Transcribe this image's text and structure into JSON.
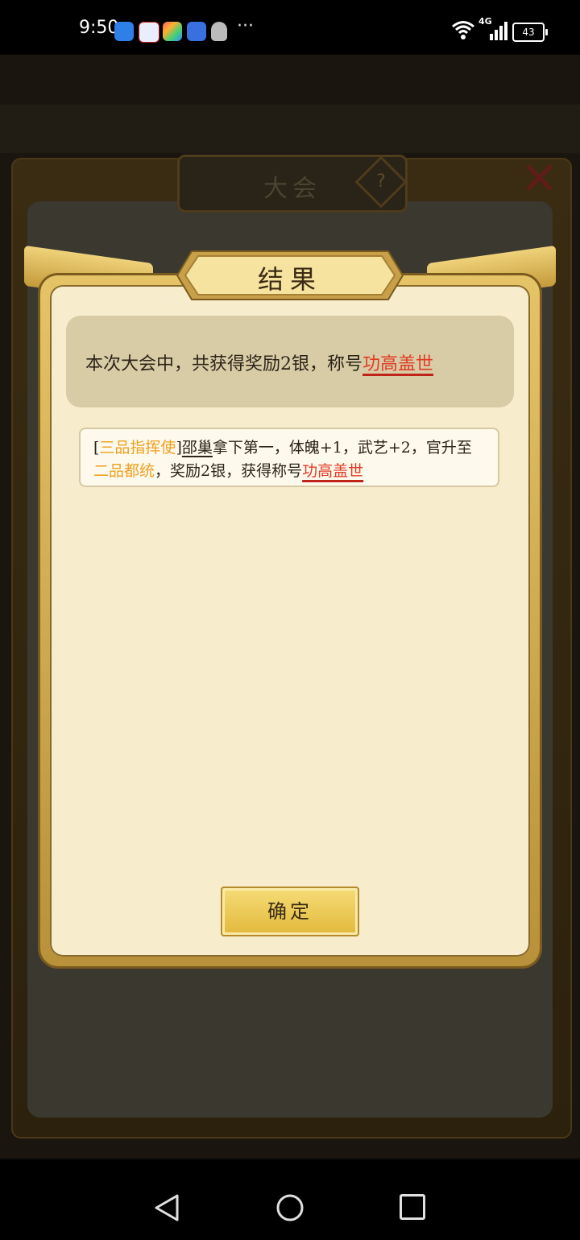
{
  "status_bar": {
    "time": "9:50",
    "network": "4G",
    "battery": "43",
    "app_icons": [
      "browser-icon",
      "baidu-icon",
      "app-store-icon",
      "education-icon",
      "qq-icon"
    ],
    "more": "···"
  },
  "background": {
    "panel_title": "大会",
    "help_label": "?"
  },
  "dialog": {
    "title": "结果",
    "summary": {
      "prefix": "本次大会中，共获得奖励2银，称号",
      "honor_title": "功高盖世"
    },
    "detail": {
      "bracket_open": "[",
      "rank_before": "三品指挥使",
      "bracket_close": "]",
      "person": "邵巢",
      "text1": "拿下第一，体魄+1，武艺+2，官升至",
      "rank_after": "二品都统",
      "text2": "，奖励2银，获得称号",
      "honor_title": "功高盖世"
    },
    "confirm_label": "确定"
  },
  "colors": {
    "accent_red": "#e23a25",
    "rank_orange": "#f0a020",
    "dialog_bg": "#f7edcd",
    "gold": "#e2b93b"
  }
}
